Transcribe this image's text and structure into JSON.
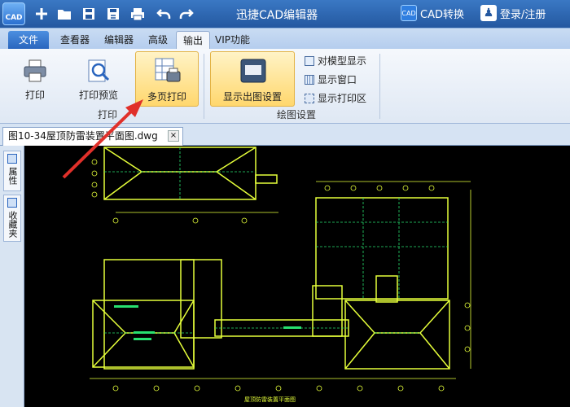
{
  "app": {
    "title": "迅捷CAD编辑器",
    "logo_text": "CAD"
  },
  "titlebar": {
    "cad_convert": "CAD转换",
    "login": "登录/注册"
  },
  "tabs": [
    {
      "label": "文件"
    },
    {
      "label": "查看器"
    },
    {
      "label": "编辑器"
    },
    {
      "label": "高级"
    },
    {
      "label": "输出"
    },
    {
      "label": "VIP功能"
    }
  ],
  "ribbon": {
    "print": "打印",
    "preview": "打印预览",
    "multi_print": "多页打印",
    "print_group": "打印",
    "show_settings": "显示出图设置",
    "model_display": "对模型显示",
    "show_window": "显示窗口",
    "print_area": "显示打印区",
    "draw_group": "绘图设置"
  },
  "document": {
    "tab_name": "图10-34屋顶防雷装置平面图.dwg",
    "close": "×"
  },
  "sidepanel": {
    "properties": "属性",
    "favorites": "收藏夹"
  },
  "drawing": {
    "title": "屋顶防雷装置平面图"
  },
  "colors": {
    "accent": "#2458a0",
    "highlight": "#ffd76d",
    "drawing_line": "#e6ff3a",
    "drawing_accent": "#28e070"
  }
}
